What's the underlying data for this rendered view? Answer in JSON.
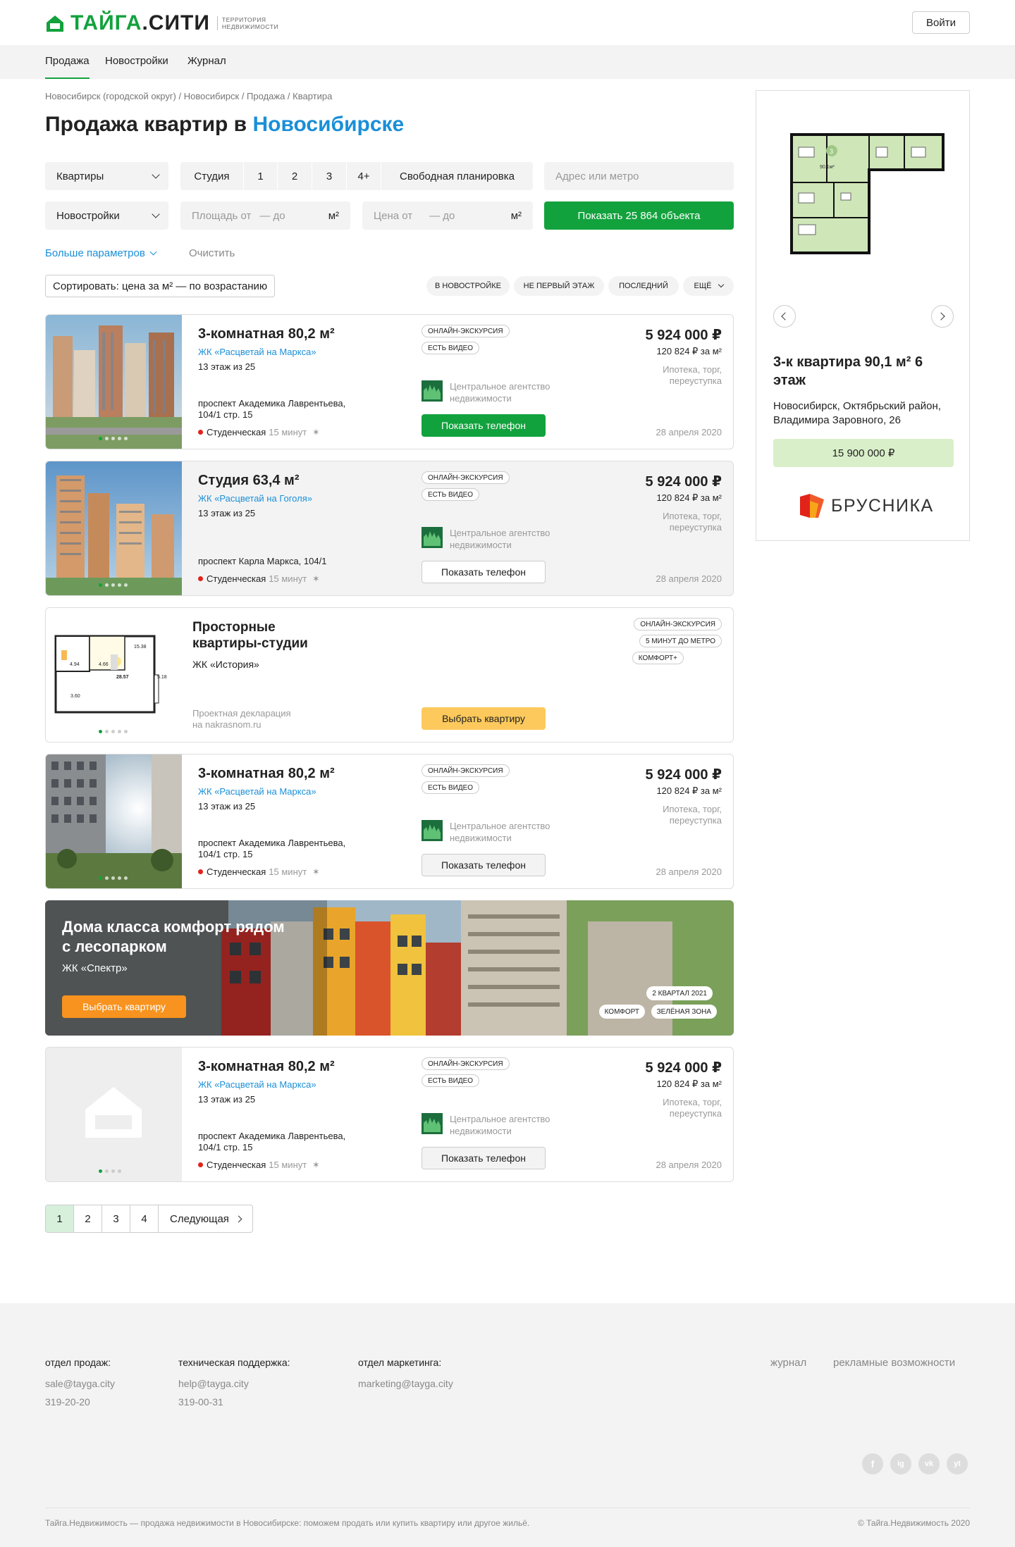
{
  "header": {
    "logo_main": "ТАЙГА",
    "logo_dot": ".",
    "logo_city": "СИТИ",
    "logo_sub_1": "ТЕРРИТОРИЯ",
    "logo_sub_2": "НЕДВИЖИМОСТИ",
    "login_label": "Войти"
  },
  "nav": {
    "items": [
      "Продажа",
      "Новостройки",
      "Журнал"
    ],
    "active": "Продажа"
  },
  "breadcrumb": "Новосибирск (городской округ) / Новосибирск / Продажа / Квартира",
  "page_title": {
    "prefix": "Продажа квартир в ",
    "accent": "Новосибирске"
  },
  "filters": {
    "type_select": "Квартиры",
    "rooms": [
      "Студия",
      "1",
      "2",
      "3",
      "4+",
      "Свободная планировка"
    ],
    "address_placeholder": "Адрес или метро",
    "market_select": "Новостройки",
    "area_from": "Площадь от",
    "area_to": "— до",
    "area_unit": "м²",
    "price_from": "Цена от",
    "price_to": "— до",
    "price_unit": "м²",
    "show_button": "Показать 25 864 объекта",
    "more_params": "Больше параметров",
    "clear": "Очистить"
  },
  "sort": {
    "label": "Сортировать: цена за м² — по возрастанию",
    "tags": [
      "В новостройке",
      "Не первый этаж",
      "Последний",
      "Ещё"
    ]
  },
  "listings": [
    {
      "title": "3-комнатная 80,2 м²",
      "complex": "ЖК «Расцветай на Маркса»",
      "floor": "13 этаж из 25",
      "address": "проспект Академика Лаврентьева, 104/1 стр. 15",
      "metro": "Студенческая",
      "walk": "15 минут",
      "badges": [
        "Онлайн-экскурсия",
        "Есть видео"
      ],
      "agency": "Центральное агентство недвижимости",
      "phone": "Показать телефон",
      "price": "5 924 000 ₽",
      "price_per_m": "120 824 ₽ за м²",
      "terms": "Ипотека, торг, переуступка",
      "date": "28 апреля 2020"
    },
    {
      "title": "Студия 63,4 м²",
      "complex": "ЖК «Расцветай на Гоголя»",
      "floor": "13 этаж из 25",
      "address": "проспект Карла Маркса, 104/1",
      "metro": "Студенческая",
      "walk": "15 минут",
      "badges": [
        "Онлайн-экскурсия",
        "Есть видео"
      ],
      "agency": "Центральное агентство недвижимости",
      "phone": "Показать телефон",
      "price": "5 924 000 ₽",
      "price_per_m": "120 824 ₽ за м²",
      "terms": "Ипотека, торг, переуступка",
      "date": "28 апреля 2020"
    },
    {
      "title": "3-комнатная 80,2 м²",
      "complex": "ЖК «Расцветай на Маркса»",
      "floor": "13 этаж из 25",
      "address": "проспект Академика Лаврентьева, 104/1 стр. 15",
      "metro": "Студенческая",
      "walk": "15 минут",
      "badges": [
        "Онлайн-экскурсия",
        "Есть видео"
      ],
      "agency": "Центральное агентство недвижимости",
      "phone": "Показать телефон",
      "price": "5 924 000 ₽",
      "price_per_m": "120 824 ₽ за м²",
      "terms": "Ипотека, торг, переуступка",
      "date": "28 апреля 2020"
    },
    {
      "title": "3-комнатная 80,2 м²",
      "complex": "ЖК «Расцветай на Маркса»",
      "floor": "13 этаж из 25",
      "address": "проспект Академика Лаврентьева, 104/1 стр. 15",
      "metro": "Студенческая",
      "walk": "15 минут",
      "badges": [
        "Онлайн-экскурсия",
        "Есть видео"
      ],
      "agency": "Центральное агентство недвижимости",
      "phone": "Показать телефон",
      "price": "5 924 000 ₽",
      "price_per_m": "120 824 ₽ за м²",
      "terms": "Ипотека, торг, переуступка",
      "date": "28 апреля 2020"
    }
  ],
  "promo_card": {
    "title": "Просторные квартиры-студии",
    "complex": "ЖК «История»",
    "note_1": "Проектная декларация",
    "note_2": "на nakrasnom.ru",
    "button": "Выбрать квартиру",
    "badges": [
      "Онлайн-экскурсия",
      "5 минут до метро",
      "Комфорт+"
    ],
    "plan_labels": [
      "15.38",
      "4.94",
      "4.66",
      "28.57",
      "5.18",
      "3.60"
    ]
  },
  "banner": {
    "title": "Дома класса комфорт рядом с лесопарком",
    "complex": "ЖК «Спектр»",
    "button": "Выбрать квартиру",
    "badges": [
      "2 квартал 2021",
      "Комфорт",
      "Зелёная зона"
    ]
  },
  "pagination": {
    "pages": [
      "1",
      "2",
      "3",
      "4"
    ],
    "current": "1",
    "next": "Следующая"
  },
  "sidebar_ad": {
    "title": "3-к квартира 90,1 м² 6 этаж",
    "address": "Новосибирск, Октябрьский район, Владимира Заровного, 26",
    "price": "15 900 000 ₽",
    "brand": "БРУСНИКА",
    "plan_room_label": "3",
    "plan_area_label": "90.1м²"
  },
  "footer": {
    "columns": [
      {
        "title": "отдел продаж:",
        "email": "sale@tayga.city",
        "phone": "319-20-20"
      },
      {
        "title": "техническая поддержка:",
        "email": "help@tayga.city",
        "phone": "319-00-31"
      },
      {
        "title": "отдел маркетинга:",
        "email": "marketing@tayga.city",
        "phone": ""
      }
    ],
    "links": [
      "журнал",
      "рекламные возможности"
    ],
    "social": [
      "f",
      "ig",
      "vk",
      "yt"
    ],
    "copy": "Тайга.Недвижимость — продажа недвижимости в Новосибирске: поможем продать или купить квартиру или другое жильё.",
    "rights": "© Тайга.Недвижимость 2020"
  },
  "colors": {
    "brand_green": "#12a23d",
    "link_blue": "#1a8fd8",
    "metro_red": "#e2231a",
    "promo_yellow": "#fdc95c",
    "banner_orange": "#f7931e"
  }
}
